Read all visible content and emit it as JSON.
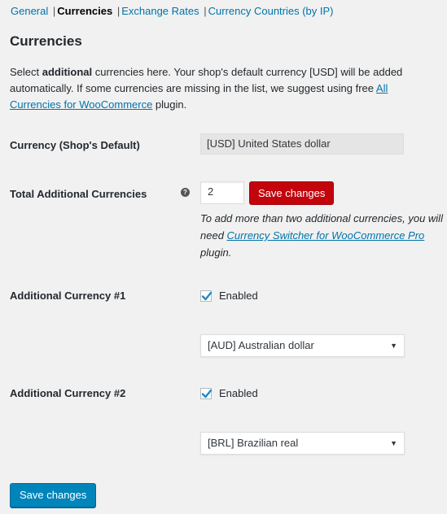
{
  "subnav": {
    "general": "General",
    "currencies": "Currencies",
    "exchange_rates": "Exchange Rates",
    "currency_countries": "Currency Countries (by IP)",
    "separator": "|"
  },
  "page": {
    "title": "Currencies",
    "desc_part1": "Select ",
    "desc_bold": "additional",
    "desc_part2": " currencies here. Your shop's default currency [USD] will be added automatically. If some currencies are missing in the list, we suggest using free ",
    "desc_link": "All Currencies for WooCommerce",
    "desc_part3": " plugin."
  },
  "fields": {
    "default_label": "Currency (Shop's Default)",
    "default_value": "[USD] United States dollar",
    "total_label": "Total Additional Currencies",
    "total_value": "2",
    "help_icon": "?",
    "save_inline": "Save changes",
    "note_text": "To add more than two additional currencies, you will need ",
    "note_link": "Currency Switcher for WooCommerce Pro",
    "note_end": " plugin.",
    "curr1_label": "Additional Currency #1",
    "curr1_enabled": "Enabled",
    "curr1_select": "[AUD] Australian dollar",
    "curr2_label": "Additional Currency #2",
    "curr2_enabled": "Enabled",
    "curr2_select": "[BRL] Brazilian real"
  },
  "footer": {
    "save_label": "Save changes"
  },
  "colors": {
    "link": "#0073aa",
    "primary_button": "#0085ba",
    "danger_button": "#c4040d",
    "background": "#f1f1f1"
  }
}
